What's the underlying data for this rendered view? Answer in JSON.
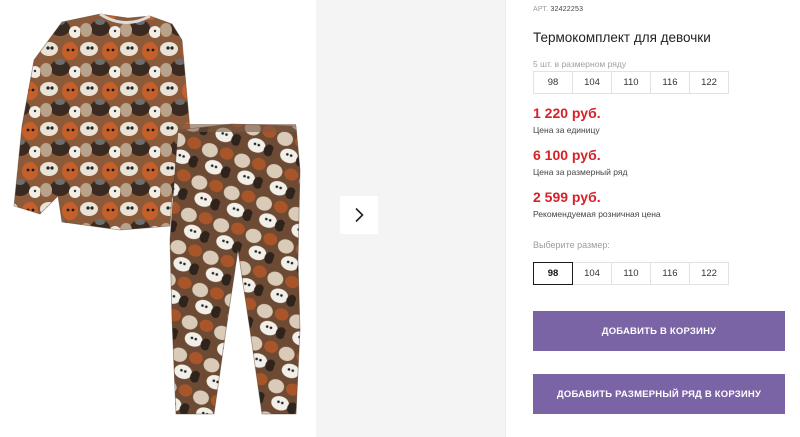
{
  "product": {
    "article_label": "АРТ.",
    "article_number": "32422253",
    "title": "Термокомплект для девочки"
  },
  "series": {
    "note": "5 шт. в размерном ряду",
    "sizes": [
      "98",
      "104",
      "110",
      "116",
      "122"
    ]
  },
  "prices": {
    "unit_price": "1 220 руб.",
    "unit_label": "Цена за единицу",
    "series_price": "6 100 руб.",
    "series_label": "Цена за размерный ряд",
    "retail_price": "2 599 руб.",
    "retail_label": "Рекомендуемая розничная цена"
  },
  "size_select": {
    "label": "Выберите размер:",
    "sizes": [
      "98",
      "104",
      "110",
      "116",
      "122"
    ],
    "selected": "98"
  },
  "buttons": {
    "add_to_cart": "ДОБАВИТЬ В КОРЗИНУ",
    "add_series_to_cart": "ДОБАВИТЬ РАЗМЕРНЫЙ РЯД В КОРЗИНУ"
  },
  "colors": {
    "price": "#d8202a",
    "button": "#7b64a5",
    "gallery_bg": "#f4f4f4"
  },
  "icons": {
    "next": "chevron-right-icon"
  }
}
